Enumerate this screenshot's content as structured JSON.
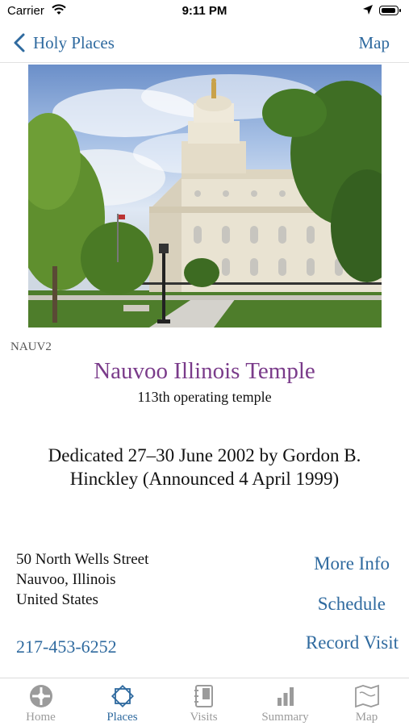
{
  "status": {
    "carrier": "Carrier",
    "time": "9:11 PM"
  },
  "nav": {
    "back_label": "Holy Places",
    "map_label": "Map"
  },
  "place": {
    "code": "NAUV2",
    "name": "Nauvoo Illinois Temple",
    "operating": "113th operating temple",
    "dedicated": "Dedicated 27–30 June 2002 by Gordon B. Hinckley (Announced 4 April 1999)",
    "address_lines": [
      "50 North Wells Street",
      "Nauvoo, Illinois",
      "United States"
    ],
    "phone": "217-453-6252"
  },
  "actions": {
    "more_info": "More Info",
    "schedule": "Schedule",
    "record_visit": "Record Visit"
  },
  "tabs": [
    {
      "label": "Home",
      "icon": "home-icon",
      "active": false
    },
    {
      "label": "Places",
      "icon": "places-icon",
      "active": true
    },
    {
      "label": "Visits",
      "icon": "visits-icon",
      "active": false
    },
    {
      "label": "Summary",
      "icon": "summary-icon",
      "active": false
    },
    {
      "label": "Map",
      "icon": "map-icon",
      "active": false
    }
  ],
  "colors": {
    "accent": "#2f6a9f",
    "title": "#7a3b8a",
    "inactive_tab": "#9b9b9b"
  }
}
